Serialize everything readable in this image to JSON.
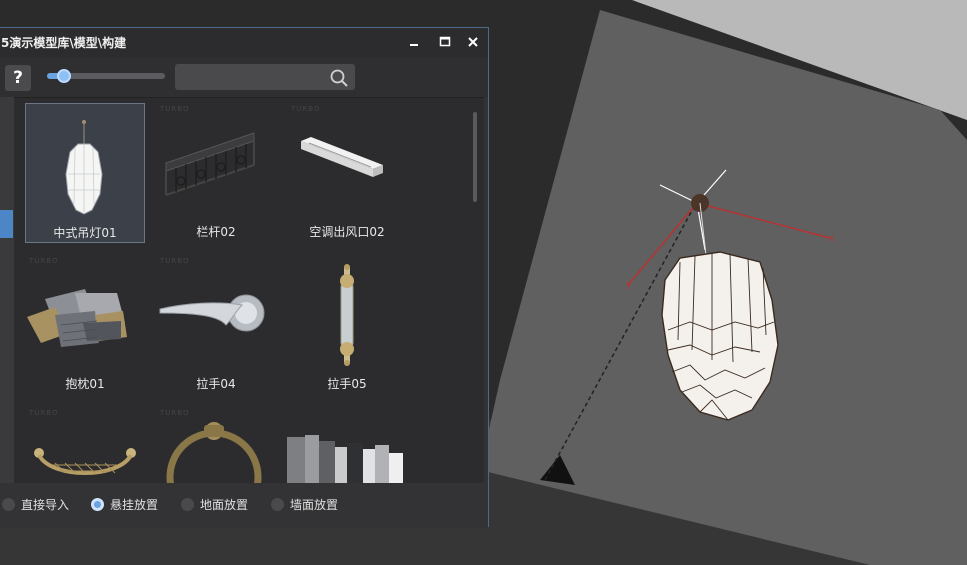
{
  "window": {
    "title": "5演示模型库\\模型\\构建",
    "minimize_glyph": "▁",
    "maximize_glyph": "☐",
    "close_glyph": "✕"
  },
  "toolbar": {
    "help_label": "?",
    "zoom_slider_fraction": 0.14,
    "search_value": "",
    "search_placeholder": "",
    "search_icon": "search-icon"
  },
  "library": {
    "items": [
      {
        "label": "中式吊灯01",
        "icon": "chandelier-thumbnail",
        "selected": true
      },
      {
        "label": "栏杆02",
        "icon": "railing-thumbnail",
        "selected": false
      },
      {
        "label": "空调出风口02",
        "icon": "ac-vent-thumbnail",
        "selected": false
      },
      {
        "label": "抱枕01",
        "icon": "pillows-thumbnail",
        "selected": false
      },
      {
        "label": "拉手04",
        "icon": "lever-handle-thumbnail",
        "selected": false
      },
      {
        "label": "拉手05",
        "icon": "bar-handle-thumbnail",
        "selected": false
      },
      {
        "label": "",
        "icon": "drawer-pull-thumbnail",
        "selected": false
      },
      {
        "label": "",
        "icon": "ring-pull-thumbnail",
        "selected": false
      },
      {
        "label": "",
        "icon": "books-thumbnail",
        "selected": false
      }
    ],
    "watermark": "TURBO"
  },
  "placement": {
    "options": [
      {
        "label": "直接导入",
        "checked": false
      },
      {
        "label": "悬挂放置",
        "checked": true
      },
      {
        "label": "地面放置",
        "checked": false
      },
      {
        "label": "墙面放置",
        "checked": false
      }
    ]
  },
  "colors": {
    "accent": "#6aa3e0",
    "window_border": "#4a6b8c",
    "axis_red": "#b83232"
  }
}
